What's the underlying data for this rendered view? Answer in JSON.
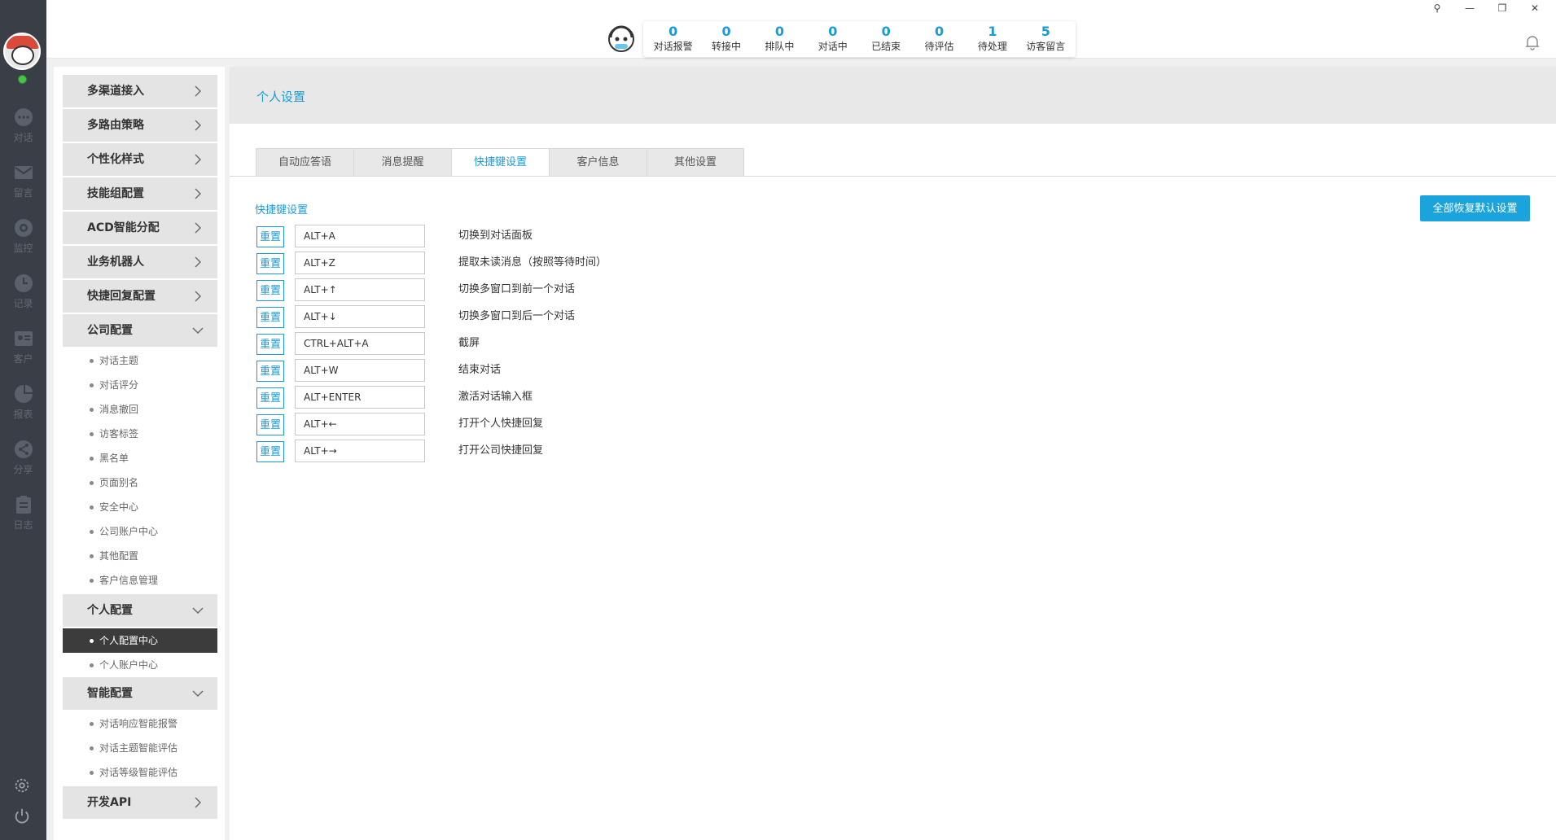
{
  "rail": {
    "items": [
      {
        "label": "对话",
        "icon": "chat-icon"
      },
      {
        "label": "留言",
        "icon": "mail-icon"
      },
      {
        "label": "监控",
        "icon": "eye-icon"
      },
      {
        "label": "记录",
        "icon": "clock-icon"
      },
      {
        "label": "客户",
        "icon": "id-card-icon"
      },
      {
        "label": "报表",
        "icon": "pie-chart-icon"
      },
      {
        "label": "分享",
        "icon": "share-icon"
      },
      {
        "label": "日志",
        "icon": "clipboard-icon"
      }
    ]
  },
  "topbar": {
    "stats": [
      {
        "num": "0",
        "label": "对话报警"
      },
      {
        "num": "0",
        "label": "转接中"
      },
      {
        "num": "0",
        "label": "排队中"
      },
      {
        "num": "0",
        "label": "对话中"
      },
      {
        "num": "0",
        "label": "已结束"
      },
      {
        "num": "0",
        "label": "待评估"
      },
      {
        "num": "1",
        "label": "待处理"
      },
      {
        "num": "5",
        "label": "访客留言"
      }
    ]
  },
  "sidebar": {
    "groups": [
      {
        "label": "多渠道接入"
      },
      {
        "label": "多路由策略"
      },
      {
        "label": "个性化样式"
      },
      {
        "label": "技能组配置"
      },
      {
        "label": "ACD智能分配"
      },
      {
        "label": "业务机器人"
      },
      {
        "label": "快捷回复配置"
      },
      {
        "label": "公司配置"
      },
      {
        "label": "个人配置"
      },
      {
        "label": "智能配置"
      },
      {
        "label": "开发API"
      }
    ],
    "company_items": [
      "对话主题",
      "对话评分",
      "消息撤回",
      "访客标签",
      "黑名单",
      "页面别名",
      "安全中心",
      "公司账户中心",
      "其他配置",
      "客户信息管理"
    ],
    "personal_items": [
      "个人配置中心",
      "个人账户中心"
    ],
    "smart_items": [
      "对话响应智能报警",
      "对话主题智能评估",
      "对话等级智能评估"
    ]
  },
  "main": {
    "title": "个人设置",
    "tabs": [
      "自动应答语",
      "消息提醒",
      "快捷键设置",
      "客户信息",
      "其他设置"
    ],
    "active_tab": "快捷键设置",
    "section_title": "快捷键设置",
    "reset_all_label": "全部恢复默认设置",
    "reset_label": "重置",
    "shortcuts": [
      {
        "key": "ALT+A",
        "desc": "切换到对话面板"
      },
      {
        "key": "ALT+Z",
        "desc": "提取未读消息（按照等待时间）"
      },
      {
        "key": "ALT+↑",
        "desc": "切换多窗口到前一个对话"
      },
      {
        "key": "ALT+↓",
        "desc": "切换多窗口到后一个对话"
      },
      {
        "key": "CTRL+ALT+A",
        "desc": "截屏"
      },
      {
        "key": "ALT+W",
        "desc": "结束对话"
      },
      {
        "key": "ALT+ENTER",
        "desc": "激活对话输入框"
      },
      {
        "key": "ALT+←",
        "desc": "打开个人快捷回复"
      },
      {
        "key": "ALT+→",
        "desc": "打开公司快捷回复"
      }
    ]
  },
  "colors": {
    "accent": "#1a9bd7",
    "rail": "#3a3f47",
    "active_nav": "#3c3c3c"
  }
}
